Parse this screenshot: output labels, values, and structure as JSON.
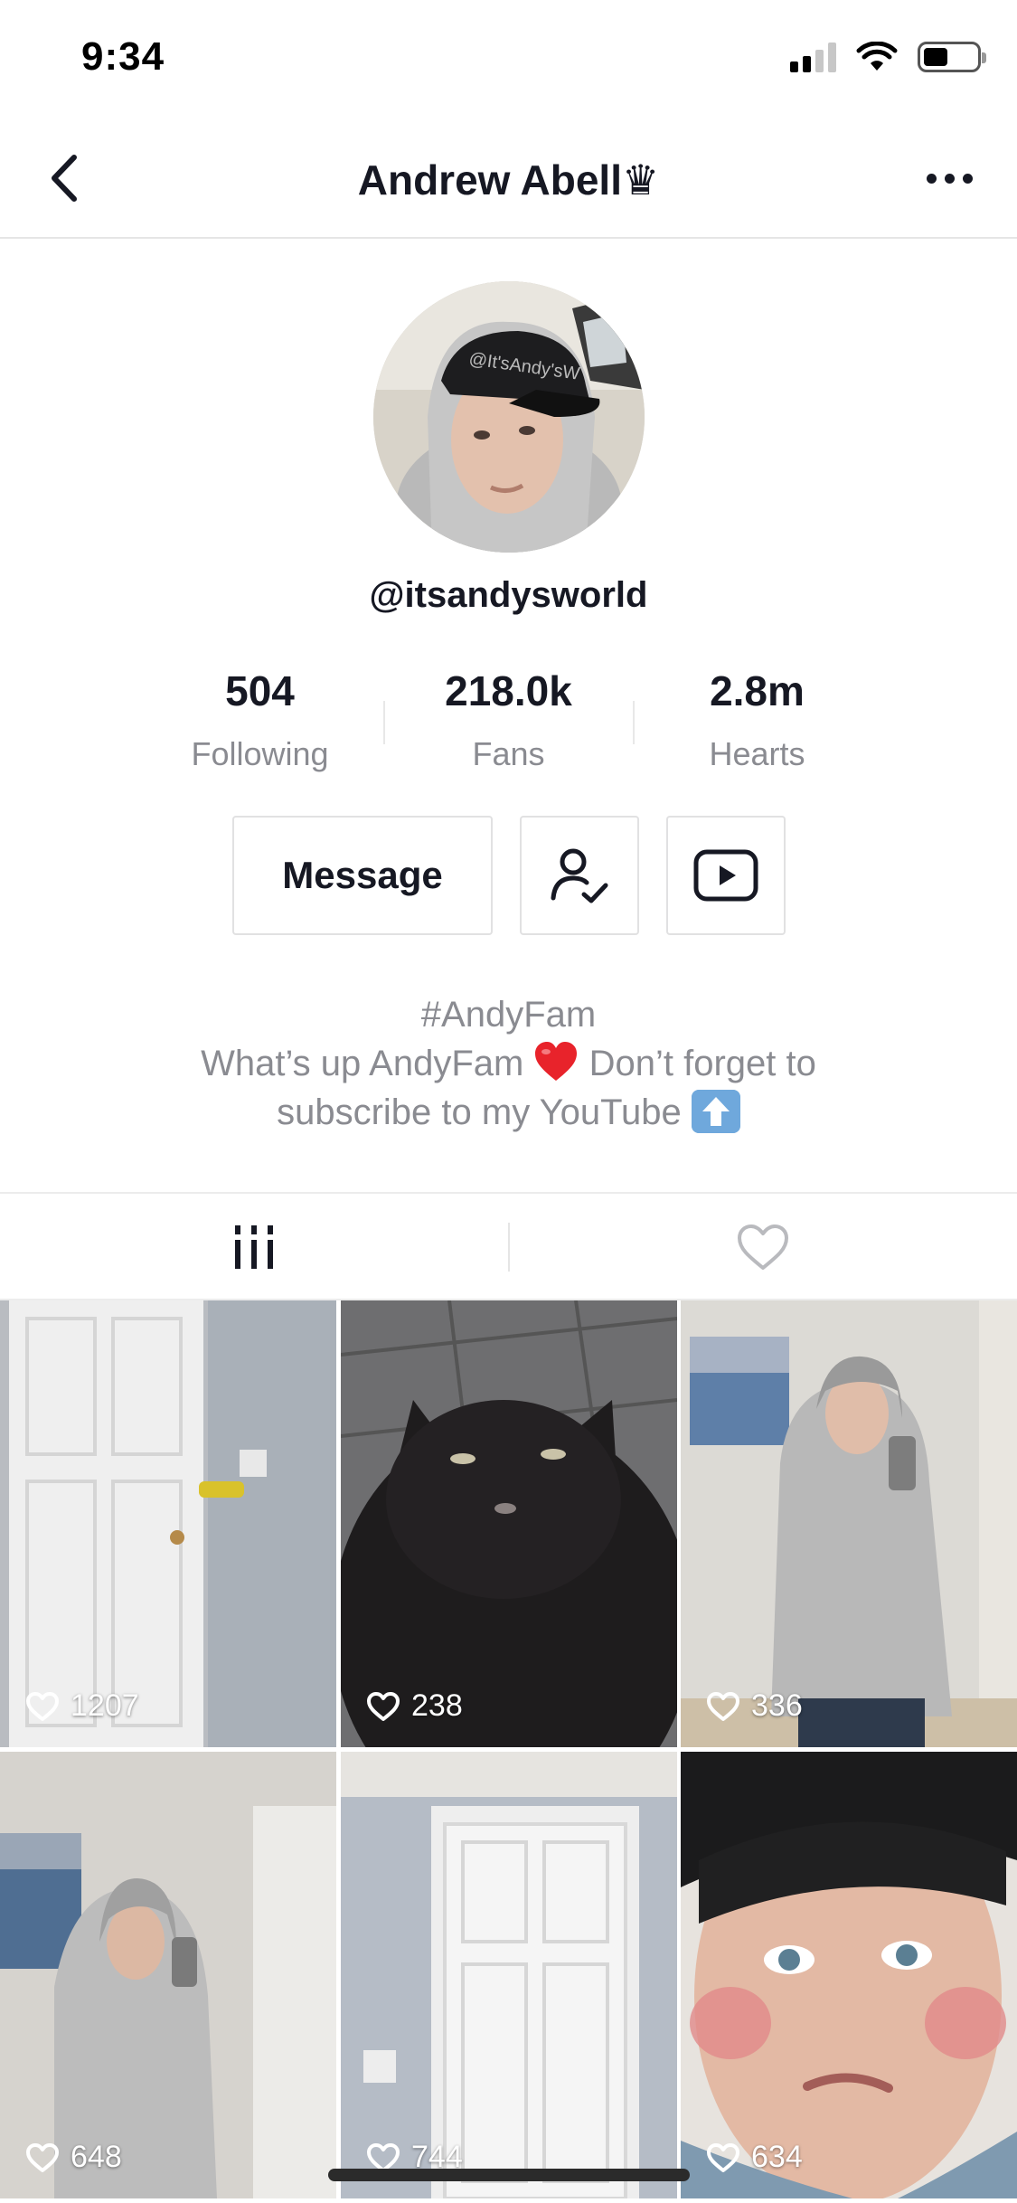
{
  "status_bar": {
    "time": "9:34"
  },
  "nav": {
    "title": "Andrew Abell♛"
  },
  "profile": {
    "username": "@itsandysworld",
    "stats": [
      {
        "value": "504",
        "label": "Following"
      },
      {
        "value": "218.0k",
        "label": "Fans"
      },
      {
        "value": "2.8m",
        "label": "Hearts"
      }
    ],
    "message_label": "Message",
    "bio": {
      "hashtag": "#AndyFam",
      "line2_a": "What’s up AndyFam",
      "line2_b": "Don’t forget to",
      "line3": "subscribe to my YouTube"
    }
  },
  "icons": {
    "back": "chevron-left-icon",
    "more": "more-horizontal-icon",
    "followed": "user-check-icon",
    "youtube": "play-button-icon",
    "videos_tab": "grid-bars-icon",
    "liked_tab": "heart-outline-icon",
    "tile_likes": "heart-outline-icon"
  },
  "videos": [
    {
      "likes": "1207",
      "scene": "door"
    },
    {
      "likes": "238",
      "scene": "cat"
    },
    {
      "likes": "336",
      "scene": "mirror"
    },
    {
      "likes": "648",
      "scene": "mirror2"
    },
    {
      "likes": "744",
      "scene": "door2"
    },
    {
      "likes": "634",
      "scene": "face"
    }
  ]
}
